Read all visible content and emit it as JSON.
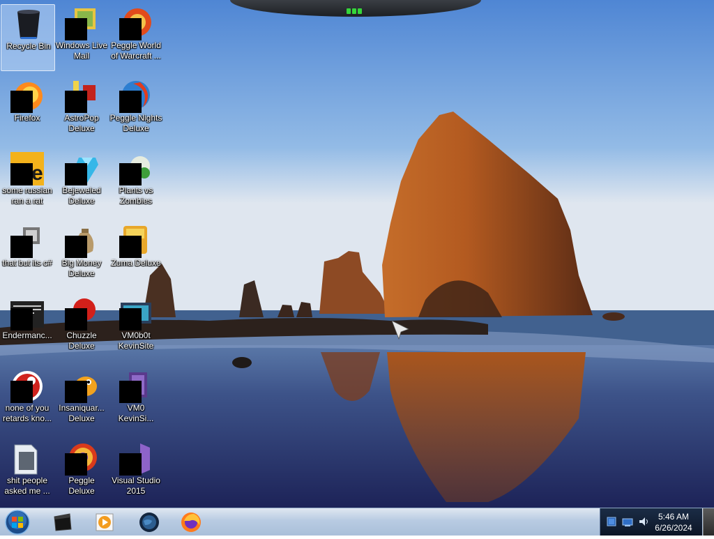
{
  "desktop": {
    "icons": [
      {
        "label": "Recycle Bin",
        "icon": "recycle-bin-icon"
      },
      {
        "label": "Windows Live\nMail",
        "icon": "windows-live-mail-icon"
      },
      {
        "label": "Peggle World\nof Warcraft ...",
        "icon": "peggle-wow-icon"
      },
      {
        "label": "Firefox",
        "icon": "firefox-icon"
      },
      {
        "label": "AstroPop\nDeluxe",
        "icon": "astropop-icon"
      },
      {
        "label": "Peggle Nights\nDeluxe",
        "icon": "peggle-nights-icon"
      },
      {
        "label": "some russian\nran a rat",
        "icon": "shortcut-file-icon"
      },
      {
        "label": "Bejeweled\nDeluxe",
        "icon": "bejeweled-icon"
      },
      {
        "label": "Plants vs\nZombies",
        "icon": "plants-vs-zombies-icon"
      },
      {
        "label": "that but its c#",
        "icon": "shortcut-file-icon"
      },
      {
        "label": "Big Money\nDeluxe",
        "icon": "big-money-icon"
      },
      {
        "label": "Zuma Deluxe",
        "icon": "zuma-icon"
      },
      {
        "label": "Endermanc...",
        "icon": "terminal-icon"
      },
      {
        "label": "Chuzzle\nDeluxe",
        "icon": "chuzzle-icon"
      },
      {
        "label": "VM0b0t\nKevinSite",
        "icon": "vm-icon"
      },
      {
        "label": "none of you\nretards kno...",
        "icon": "peggle-icon"
      },
      {
        "label": "Insaniquar...\nDeluxe",
        "icon": "insaniquarium-icon"
      },
      {
        "label": "VM0\nKevinSi...",
        "icon": "vm-icon"
      },
      {
        "label": "shit people\nasked me ...",
        "icon": "folder-icon"
      },
      {
        "label": "Peggle Deluxe",
        "icon": "peggle-icon"
      },
      {
        "label": "Visual Studio\n2015",
        "icon": "visual-studio-icon"
      }
    ]
  },
  "taskbar": {
    "start": "windows-start-orb-icon",
    "pinned": [
      "command-prompt-icon",
      "windows-media-player-icon",
      "network-globe-icon",
      "firefox-icon"
    ],
    "tray_icons": [
      "action-center-icon",
      "network-icon",
      "volume-icon"
    ],
    "time": "5:46 AM",
    "date": "6/26/2024"
  },
  "colors": {
    "taskbar": "#b8cbe2",
    "tray": "#0c1626",
    "sky": "#5c94d8",
    "selection": "#bed7f5"
  }
}
